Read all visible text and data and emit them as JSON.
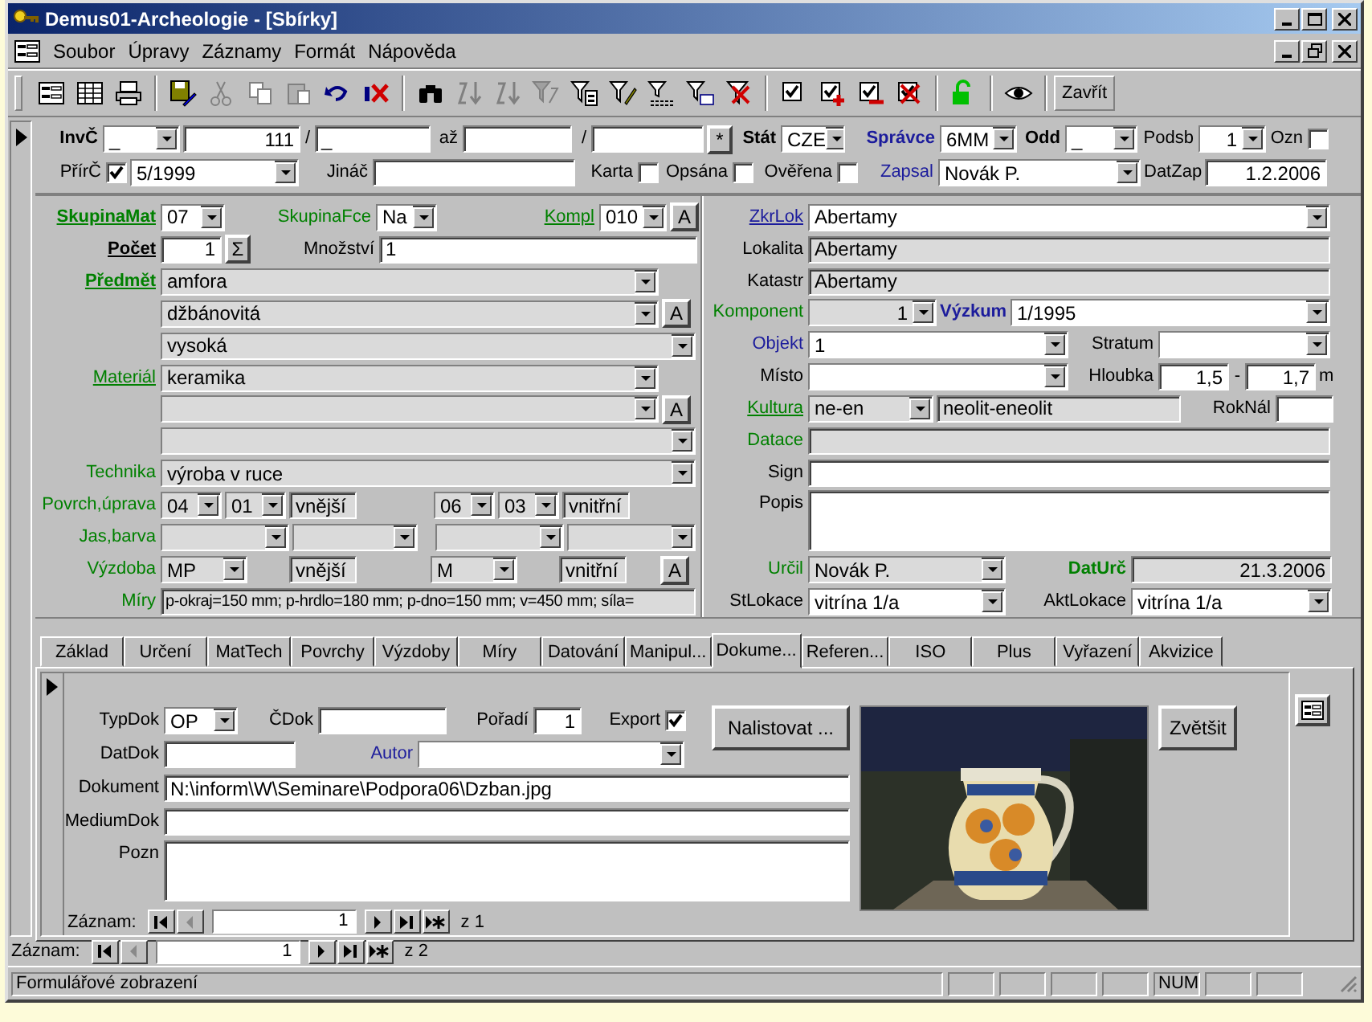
{
  "window": {
    "title": "Demus01-Archeologie - [Sbírky]"
  },
  "menu": [
    "Soubor",
    "Úpravy",
    "Záznamy",
    "Formát",
    "Nápověda"
  ],
  "toolbar": {
    "close_label": "Zavřít"
  },
  "header": {
    "rows": [
      {
        "fields": [
          {
            "kind": "label",
            "text": "InvČ",
            "color": "#000000",
            "bold": true,
            "underlined": false
          },
          {
            "kind": "combo",
            "value": "_",
            "locked": false
          },
          {
            "kind": "text",
            "value": "111",
            "locked": false
          },
          {
            "kind": "label",
            "text": "/",
            "color": "#000000",
            "bold": false,
            "underlined": false
          },
          {
            "kind": "text",
            "value": "_",
            "locked": false
          },
          {
            "kind": "label",
            "text": "až",
            "color": "#000000",
            "bold": false,
            "underlined": false
          },
          {
            "kind": "text",
            "locked": false
          },
          {
            "kind": "label",
            "text": "/",
            "color": "#000000",
            "bold": false,
            "underlined": false
          },
          {
            "kind": "text",
            "locked": false
          },
          {
            "kind": "button",
            "text": "*"
          },
          {
            "kind": "label",
            "text": "Stát",
            "color": "#000000",
            "bold": true,
            "underlined": false
          },
          {
            "kind": "combo",
            "value": "CZE",
            "locked": false
          },
          {
            "kind": "label",
            "text": "Správce",
            "color": "#1c1c9c",
            "bold": true,
            "underlined": false
          },
          {
            "kind": "combo",
            "value": "6MM",
            "locked": false
          },
          {
            "kind": "label",
            "text": "Odd",
            "color": "#000000",
            "bold": true,
            "underlined": false
          },
          {
            "kind": "combo",
            "value": "_",
            "locked": false
          },
          {
            "kind": "label",
            "text": "Podsb",
            "color": "#000000",
            "bold": false,
            "underlined": false
          },
          {
            "kind": "combo",
            "value": "1",
            "locked": false
          },
          {
            "kind": "label",
            "text": "Ozn",
            "color": "#000000",
            "bold": false,
            "underlined": false
          },
          {
            "kind": "check",
            "checked": false
          }
        ]
      },
      {
        "fields": [
          {
            "kind": "label",
            "text": "PřírČ",
            "color": "#000000",
            "bold": false,
            "underlined": false
          },
          {
            "kind": "check",
            "checked": true
          },
          {
            "kind": "combo",
            "value": "5/1999",
            "locked": false
          },
          {
            "kind": "label",
            "text": "Jináč",
            "color": "#000000",
            "bold": false,
            "underlined": false
          },
          {
            "kind": "text",
            "locked": false
          },
          {
            "kind": "label",
            "text": "Karta",
            "color": "#000000",
            "bold": false,
            "underlined": false
          },
          {
            "kind": "check",
            "checked": false
          },
          {
            "kind": "label",
            "text": "Opsána",
            "color": "#000000",
            "bold": false,
            "underlined": false
          },
          {
            "kind": "check",
            "checked": false
          },
          {
            "kind": "label",
            "text": "Ověřena",
            "color": "#000000",
            "bold": false,
            "underlined": false
          },
          {
            "kind": "check",
            "checked": false
          },
          {
            "kind": "label",
            "text": "Zapsal",
            "color": "#1c1c9c",
            "bold": false,
            "underlined": false
          },
          {
            "kind": "combo",
            "value": "Novák P.",
            "locked": false
          },
          {
            "kind": "label",
            "text": "DatZap",
            "color": "#000000",
            "bold": false,
            "underlined": false
          },
          {
            "kind": "text",
            "value": "1.2.2006",
            "locked": false
          }
        ]
      }
    ]
  },
  "detail": {
    "left": [
      {
        "fields": [
          {
            "kind": "label",
            "text": "SkupinaMat",
            "color": "#008000",
            "bold": true,
            "underlined": true
          },
          {
            "kind": "combo",
            "value": "07",
            "locked": false
          },
          {
            "kind": "label",
            "text": "SkupinaFce",
            "color": "#008000",
            "bold": false,
            "underlined": false
          },
          {
            "kind": "combo",
            "value": "Na",
            "locked": false
          },
          {
            "kind": "label",
            "text": "Kompl",
            "color": "#008000",
            "bold": false,
            "underlined": true
          },
          {
            "kind": "combo",
            "value": "010",
            "locked": false
          },
          {
            "kind": "button",
            "text": "A"
          }
        ]
      },
      {
        "fields": [
          {
            "kind": "label",
            "text": "Počet",
            "color": "#000000",
            "bold": true,
            "underlined": true
          },
          {
            "kind": "text",
            "value": "1",
            "locked": false
          },
          {
            "kind": "button",
            "text": "Σ"
          },
          {
            "kind": "label",
            "text": "Množství",
            "color": "#000000",
            "bold": false,
            "underlined": false
          },
          {
            "kind": "text",
            "value": "1",
            "locked": false
          }
        ]
      },
      {
        "fields": [
          {
            "kind": "label",
            "text": "Předmět",
            "color": "#008000",
            "bold": true,
            "underlined": true
          },
          {
            "kind": "combo",
            "value": "amfora",
            "locked": true
          }
        ]
      },
      {
        "fields": [
          {
            "kind": "combo",
            "value": "džbánovitá",
            "locked": true
          },
          {
            "kind": "button",
            "text": "A"
          }
        ]
      },
      {
        "fields": [
          {
            "kind": "combo",
            "value": "vysoká",
            "locked": true
          }
        ]
      },
      {
        "fields": [
          {
            "kind": "label",
            "text": "Materiál",
            "color": "#008000",
            "bold": false,
            "underlined": true
          },
          {
            "kind": "combo",
            "value": "keramika",
            "locked": true
          }
        ]
      },
      {
        "fields": [
          {
            "kind": "combo",
            "locked": true
          },
          {
            "kind": "button",
            "text": "A"
          }
        ]
      },
      {
        "fields": [
          {
            "kind": "combo",
            "locked": true
          }
        ]
      },
      {
        "fields": [
          {
            "kind": "label",
            "text": "Technika",
            "color": "#008000",
            "bold": false,
            "underlined": false
          },
          {
            "kind": "combo",
            "value": "výroba v ruce",
            "locked": true
          }
        ]
      },
      {
        "fields": [
          {
            "kind": "label",
            "text": "Povrch,úprava",
            "color": "#008000",
            "bold": false,
            "underlined": false
          },
          {
            "kind": "combo",
            "value": "04",
            "locked": true
          },
          {
            "kind": "combo",
            "value": "01",
            "locked": true
          },
          {
            "kind": "text",
            "value": "vnější",
            "locked": true
          },
          {
            "kind": "combo",
            "value": "06",
            "locked": true
          },
          {
            "kind": "combo",
            "value": "03",
            "locked": true
          },
          {
            "kind": "text",
            "value": "vnitřní",
            "locked": true
          }
        ]
      },
      {
        "fields": [
          {
            "kind": "label",
            "text": "Jas,barva",
            "color": "#008000",
            "bold": false,
            "underlined": false
          },
          {
            "kind": "combo",
            "locked": true
          },
          {
            "kind": "combo",
            "locked": true
          },
          {
            "kind": "combo",
            "locked": true
          },
          {
            "kind": "combo",
            "locked": true
          }
        ]
      },
      {
        "fields": [
          {
            "kind": "label",
            "text": "Výzdoba",
            "color": "#008000",
            "bold": false,
            "underlined": false
          },
          {
            "kind": "combo",
            "value": "MP",
            "locked": true
          },
          {
            "kind": "text",
            "value": "vnější",
            "locked": true
          },
          {
            "kind": "combo",
            "value": "M",
            "locked": true
          },
          {
            "kind": "text",
            "value": "vnitřní",
            "locked": true
          },
          {
            "kind": "button",
            "text": "A"
          }
        ]
      },
      {
        "fields": [
          {
            "kind": "label",
            "text": "Míry",
            "color": "#008000",
            "bold": false,
            "underlined": false
          },
          {
            "kind": "text",
            "value": "p-okraj=150 mm; p-hrdlo=180 mm; p-dno=150 mm; v=450 mm; síla=",
            "locked": true
          }
        ]
      }
    ],
    "right": [
      {
        "fields": [
          {
            "kind": "label",
            "text": "ZkrLok",
            "color": "#1c1c9c",
            "bold": false,
            "underlined": true
          },
          {
            "kind": "combo",
            "value": "Abertamy",
            "locked": false
          }
        ]
      },
      {
        "fields": [
          {
            "kind": "label",
            "text": "Lokalita",
            "color": "#000000",
            "bold": false,
            "underlined": false
          },
          {
            "kind": "text",
            "value": "Abertamy",
            "locked": true
          }
        ]
      },
      {
        "fields": [
          {
            "kind": "label",
            "text": "Katastr",
            "color": "#000000",
            "bold": false,
            "underlined": false
          },
          {
            "kind": "text",
            "value": "Abertamy",
            "locked": true
          }
        ]
      },
      {
        "fields": [
          {
            "kind": "label",
            "text": "Komponent",
            "color": "#008000",
            "bold": false,
            "underlined": false
          },
          {
            "kind": "combo",
            "value": "1",
            "locked": true
          },
          {
            "kind": "label",
            "text": "Výzkum",
            "color": "#1c1c9c",
            "bold": true,
            "underlined": false
          },
          {
            "kind": "combo",
            "value": "1/1995",
            "locked": false
          }
        ]
      },
      {
        "fields": [
          {
            "kind": "label",
            "text": "Objekt",
            "color": "#1c1c9c",
            "bold": false,
            "underlined": false
          },
          {
            "kind": "combo",
            "value": "1",
            "locked": false
          },
          {
            "kind": "label",
            "text": "Stratum",
            "color": "#000000",
            "bold": false,
            "underlined": false
          },
          {
            "kind": "combo",
            "locked": false
          }
        ]
      },
      {
        "fields": [
          {
            "kind": "label",
            "text": "Místo",
            "color": "#000000",
            "bold": false,
            "underlined": false
          },
          {
            "kind": "combo",
            "locked": false
          },
          {
            "kind": "label",
            "text": "Hloubka",
            "color": "#000000",
            "bold": false,
            "underlined": false
          },
          {
            "kind": "text",
            "value": "1,5",
            "locked": false
          },
          {
            "kind": "label",
            "text": "-",
            "color": "#000000",
            "bold": false,
            "underlined": false
          },
          {
            "kind": "text",
            "value": "1,7",
            "locked": false
          },
          {
            "kind": "label",
            "text": "m",
            "color": "#000000",
            "bold": false,
            "underlined": false
          }
        ]
      },
      {
        "fields": [
          {
            "kind": "label",
            "text": "Kultura",
            "color": "#008000",
            "bold": false,
            "underlined": true
          },
          {
            "kind": "combo",
            "value": "ne-en",
            "locked": true
          },
          {
            "kind": "text",
            "value": "neolit-eneolit",
            "locked": true
          },
          {
            "kind": "label",
            "text": "RokNál",
            "color": "#000000",
            "bold": false,
            "underlined": false
          },
          {
            "kind": "text",
            "locked": false
          }
        ]
      },
      {
        "fields": [
          {
            "kind": "label",
            "text": "Datace",
            "color": "#008000",
            "bold": false,
            "underlined": false
          },
          {
            "kind": "text",
            "locked": true
          }
        ]
      },
      {
        "fields": [
          {
            "kind": "label",
            "text": "Sign",
            "color": "#000000",
            "bold": false,
            "underlined": false
          },
          {
            "kind": "text",
            "locked": false
          }
        ]
      },
      {
        "fields": [
          {
            "kind": "label",
            "text": "Popis",
            "color": "#000000",
            "bold": false,
            "underlined": false
          },
          {
            "kind": "text",
            "locked": false
          }
        ]
      },
      {
        "fields": [
          {
            "kind": "label",
            "text": "Určil",
            "color": "#008000",
            "bold": false,
            "underlined": false
          },
          {
            "kind": "combo",
            "value": "Novák P.",
            "locked": true
          },
          {
            "kind": "label",
            "text": "DatUrč",
            "color": "#008000",
            "bold": true,
            "underlined": false
          },
          {
            "kind": "text",
            "value": "21.3.2006",
            "locked": true
          }
        ]
      },
      {
        "fields": [
          {
            "kind": "label",
            "text": "StLokace",
            "color": "#000000",
            "bold": false,
            "underlined": false
          },
          {
            "kind": "combo",
            "value": "vitrína 1/a",
            "locked": false
          },
          {
            "kind": "label",
            "text": "AktLokace",
            "color": "#000000",
            "bold": false,
            "underlined": false
          },
          {
            "kind": "combo",
            "value": "vitrína 1/a",
            "locked": false
          }
        ]
      }
    ]
  },
  "tabs": [
    {
      "label": "Základ",
      "selected": false
    },
    {
      "label": "Určení",
      "selected": false
    },
    {
      "label": "MatTech",
      "selected": false
    },
    {
      "label": "Povrchy",
      "selected": false
    },
    {
      "label": "Výzdoby",
      "selected": false
    },
    {
      "label": "Míry",
      "selected": false
    },
    {
      "label": "Datování",
      "selected": false
    },
    {
      "label": "Manipul...",
      "selected": false
    },
    {
      "label": "Dokume...",
      "selected": true
    },
    {
      "label": "Referen...",
      "selected": false
    },
    {
      "label": "ISO",
      "selected": false
    },
    {
      "label": "Plus",
      "selected": false
    },
    {
      "label": "Vyřazení",
      "selected": false
    },
    {
      "label": "Akvizice",
      "selected": false
    }
  ],
  "subform": {
    "rows": [
      {
        "fields": [
          {
            "kind": "label",
            "text": "TypDok",
            "color": "#000000",
            "bold": false,
            "underlined": false
          },
          {
            "kind": "combo",
            "value": "OP",
            "locked": false
          },
          {
            "kind": "label",
            "text": "ČDok",
            "color": "#000000",
            "bold": false,
            "underlined": false
          },
          {
            "kind": "text",
            "locked": false
          },
          {
            "kind": "label",
            "text": "Pořadí",
            "color": "#000000",
            "bold": false,
            "underlined": false
          },
          {
            "kind": "text",
            "value": "1",
            "locked": false
          },
          {
            "kind": "label",
            "text": "Export",
            "color": "#000000",
            "bold": false,
            "underlined": false
          },
          {
            "kind": "check",
            "checked": true
          }
        ]
      },
      {
        "fields": [
          {
            "kind": "label",
            "text": "DatDok",
            "color": "#000000",
            "bold": false,
            "underlined": false
          },
          {
            "kind": "text",
            "locked": false
          },
          {
            "kind": "label",
            "text": "Autor",
            "color": "#1c1c9c",
            "bold": false,
            "underlined": false
          },
          {
            "kind": "combo",
            "locked": false
          }
        ]
      },
      {
        "fields": [
          {
            "kind": "label",
            "text": "Dokument",
            "color": "#000000",
            "bold": false,
            "underlined": false
          },
          {
            "kind": "text",
            "value": "N:\\inform\\W\\Seminare\\Podpora06\\Dzban.jpg",
            "locked": false
          }
        ]
      },
      {
        "fields": [
          {
            "kind": "label",
            "text": "MediumDok",
            "color": "#000000",
            "bold": false,
            "underlined": false
          },
          {
            "kind": "text",
            "locked": false
          }
        ]
      },
      {
        "fields": [
          {
            "kind": "label",
            "text": "Pozn",
            "color": "#000000",
            "bold": false,
            "underlined": false
          },
          {
            "kind": "text",
            "locked": false
          }
        ]
      }
    ],
    "browse_button": "Nalistovat ...",
    "zoom_button": "Zvětšit",
    "nav": {
      "label": "Záznam:",
      "current": "1",
      "total": "z 1",
      "buttons": [
        {
          "kind": "first",
          "disabled": false
        },
        {
          "kind": "prev",
          "disabled": true
        },
        {
          "kind": "next",
          "disabled": false
        },
        {
          "kind": "last",
          "disabled": false
        },
        {
          "kind": "new",
          "disabled": false
        }
      ]
    }
  },
  "nav": {
    "label": "Záznam:",
    "current": "1",
    "total": "z 2",
    "buttons": [
      {
        "kind": "first",
        "disabled": false
      },
      {
        "kind": "prev",
        "disabled": true
      },
      {
        "kind": "next",
        "disabled": false
      },
      {
        "kind": "last",
        "disabled": false
      },
      {
        "kind": "new",
        "disabled": false
      }
    ]
  },
  "status_bar": {
    "text": "Formulářové zobrazení",
    "num": "NUM"
  }
}
